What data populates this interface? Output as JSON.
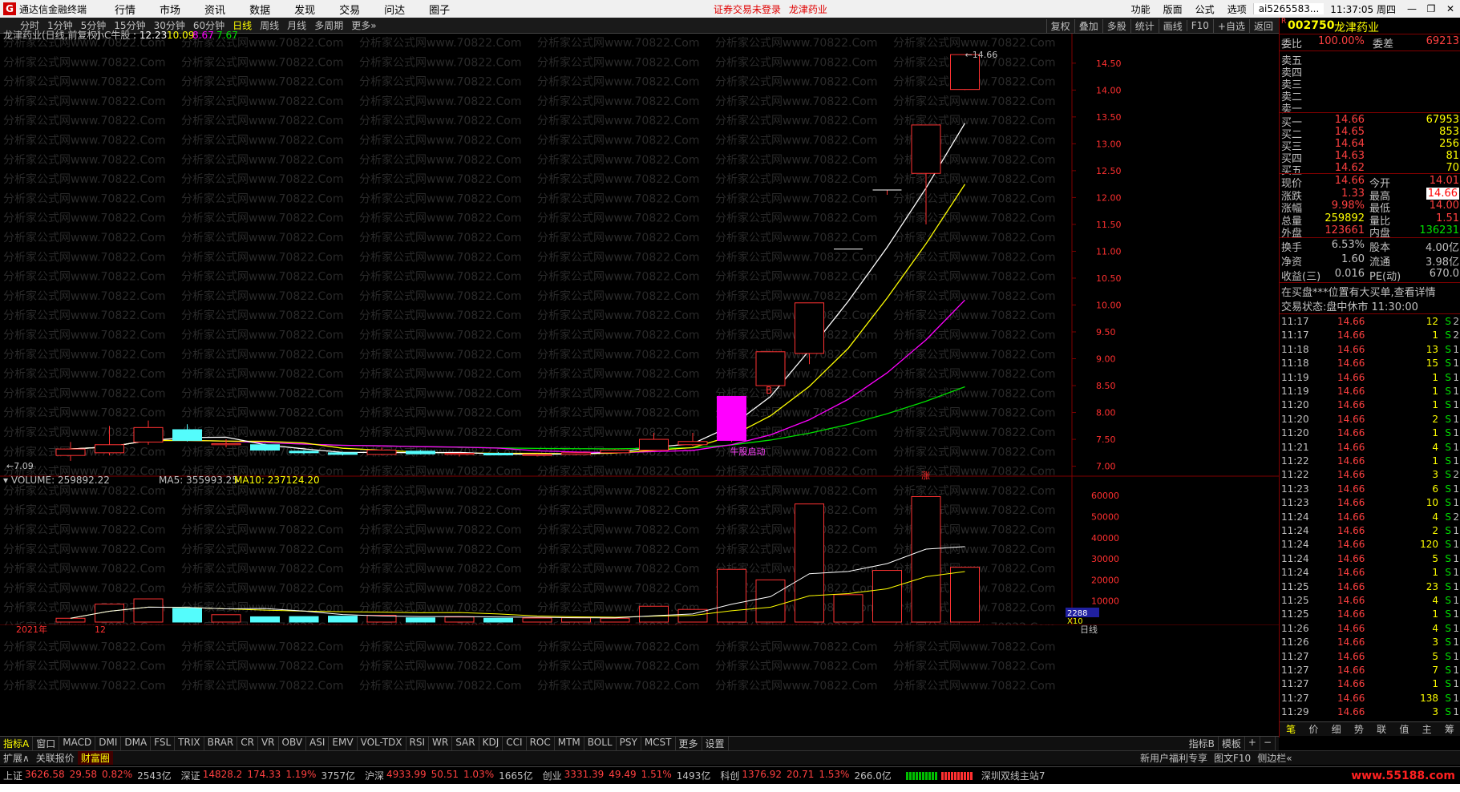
{
  "menubar": {
    "app_title": "通达信金融终端",
    "items": [
      "行情",
      "市场",
      "资讯",
      "数据",
      "发现",
      "交易",
      "问达",
      "圈子"
    ],
    "notice": [
      "证券交易未登录",
      "龙津药业"
    ],
    "right_items": [
      "功能",
      "版面",
      "公式",
      "选项"
    ],
    "account": "ai5265583...",
    "clock": "11:37:05 周四"
  },
  "periods": [
    "分时",
    "1分钟",
    "5分钟",
    "15分钟",
    "30分钟",
    "60分钟",
    "日线",
    "周线",
    "月线",
    "多周期",
    "更多»"
  ],
  "right_tools": [
    "复权",
    "叠加",
    "多股",
    "统计",
    "画线",
    "F10",
    "+自选",
    "返回"
  ],
  "chart": {
    "title": "龙津药业(日线,前复权)",
    "indicator_name": "小C牛股",
    "ind_a": "12.23",
    "ind_b": "10.09",
    "ind_c": "8.67",
    "ind_d": "7.67",
    "high_label": "14.66",
    "low_label": "7.09",
    "signal_b": "B",
    "signal_text": "牛股启动",
    "signal_up": "涨",
    "vol_label": "VOLUME: 259892.22",
    "ma5_label": "MA5: 355993.25",
    "ma10_label": "MA10: 237124.20",
    "year_label": "2021年",
    "month_label": "12",
    "period_label": "日线",
    "vol_badge": "2288",
    "vol_unit": "X10",
    "watermark": "分析家公式网www.70822.Com"
  },
  "chart_data": {
    "type": "candlestick",
    "ylim": [
      6.8,
      14.9
    ],
    "yticks": [
      7.0,
      7.5,
      8.0,
      8.5,
      9.0,
      9.5,
      10.0,
      10.5,
      11.0,
      11.5,
      12.0,
      12.5,
      13.0,
      13.5,
      14.0,
      14.5
    ],
    "candles": [
      {
        "o": 7.2,
        "h": 7.45,
        "l": 7.1,
        "c": 7.32
      },
      {
        "o": 7.25,
        "h": 7.75,
        "l": 7.2,
        "c": 7.4
      },
      {
        "o": 7.45,
        "h": 7.85,
        "l": 7.4,
        "c": 7.72
      },
      {
        "o": 7.68,
        "h": 7.78,
        "l": 7.46,
        "c": 7.48
      },
      {
        "o": 7.4,
        "h": 7.5,
        "l": 7.35,
        "c": 7.42
      },
      {
        "o": 7.4,
        "h": 7.42,
        "l": 7.28,
        "c": 7.3
      },
      {
        "o": 7.28,
        "h": 7.3,
        "l": 7.22,
        "c": 7.25
      },
      {
        "o": 7.25,
        "h": 7.27,
        "l": 7.2,
        "c": 7.22
      },
      {
        "o": 7.22,
        "h": 7.35,
        "l": 7.2,
        "c": 7.3
      },
      {
        "o": 7.28,
        "h": 7.3,
        "l": 7.22,
        "c": 7.23
      },
      {
        "o": 7.22,
        "h": 7.25,
        "l": 7.18,
        "c": 7.24
      },
      {
        "o": 7.24,
        "h": 7.26,
        "l": 7.2,
        "c": 7.21
      },
      {
        "o": 7.2,
        "h": 7.23,
        "l": 7.18,
        "c": 7.22
      },
      {
        "o": 7.22,
        "h": 7.26,
        "l": 7.2,
        "c": 7.25
      },
      {
        "o": 7.25,
        "h": 7.32,
        "l": 7.24,
        "c": 7.3
      },
      {
        "o": 7.3,
        "h": 7.62,
        "l": 7.28,
        "c": 7.5
      },
      {
        "o": 7.4,
        "h": 7.62,
        "l": 7.38,
        "c": 7.46
      },
      {
        "o": 7.48,
        "h": 8.3,
        "l": 7.45,
        "c": 8.3
      },
      {
        "o": 8.5,
        "h": 9.13,
        "l": 8.5,
        "c": 9.13
      },
      {
        "o": 9.1,
        "h": 10.04,
        "l": 8.9,
        "c": 10.04
      },
      {
        "o": 11.04,
        "h": 11.04,
        "l": 11.04,
        "c": 11.04
      },
      {
        "o": 12.14,
        "h": 12.14,
        "l": 12.05,
        "c": 12.14
      },
      {
        "o": 12.45,
        "h": 13.35,
        "l": 11.5,
        "c": 13.35
      },
      {
        "o": 14.01,
        "h": 14.66,
        "l": 14.0,
        "c": 14.66
      }
    ],
    "volume_ylim": [
      0,
      65000
    ],
    "volume_ticks": [
      10000,
      20000,
      30000,
      40000,
      50000,
      60000
    ],
    "volumes": [
      1800,
      8500,
      11000,
      6500,
      3500,
      2500,
      2600,
      2800,
      3200,
      2000,
      2400,
      1800,
      1900,
      2000,
      1800,
      7500,
      6000,
      25000,
      20000,
      56000,
      13000,
      24500,
      59500,
      26000
    ]
  },
  "sidebar": {
    "code": "002750",
    "name": "龙津药业",
    "weibi_label": "委比",
    "weibi": "100.00%",
    "weicha_label": "委差",
    "weicha": "69213",
    "asks": [
      "卖五",
      "卖四",
      "卖三",
      "卖二",
      "卖一"
    ],
    "bids": [
      {
        "l": "买一",
        "p": "14.66",
        "v": "67953"
      },
      {
        "l": "买二",
        "p": "14.65",
        "v": "853"
      },
      {
        "l": "买三",
        "p": "14.64",
        "v": "256"
      },
      {
        "l": "买四",
        "p": "14.63",
        "v": "81"
      },
      {
        "l": "买五",
        "p": "14.62",
        "v": "70"
      }
    ],
    "quote": [
      {
        "l": "现价",
        "a": "14.66",
        "l2": "今开",
        "b": "14.01"
      },
      {
        "l": "涨跌",
        "a": "1.33",
        "l2": "最高",
        "b": "14.66"
      },
      {
        "l": "涨幅",
        "a": "9.98%",
        "l2": "最低",
        "b": "14.00"
      },
      {
        "l": "总量",
        "a": "259892",
        "l2": "量比",
        "b": "1.51"
      },
      {
        "l": "外盘",
        "a": "123661",
        "l2": "内盘",
        "b": "136231"
      }
    ],
    "fund": [
      {
        "l": "换手",
        "a": "6.53%",
        "l2": "股本",
        "b": "4.00亿"
      },
      {
        "l": "净资",
        "a": "1.60",
        "l2": "流通",
        "b": "3.98亿"
      },
      {
        "l": "收益(三)",
        "a": "0.016",
        "l2": "PE(动)",
        "b": "670.0"
      }
    ],
    "msg1": "在买盘***位置有大买单,查看详情",
    "msg2": "交易状态:盘中休市 11:30:00",
    "ticks": [
      {
        "t": "11:17",
        "p": "14.66",
        "v": "12",
        "n": "2"
      },
      {
        "t": "11:17",
        "p": "14.66",
        "v": "1",
        "n": "2"
      },
      {
        "t": "11:18",
        "p": "14.66",
        "v": "13",
        "n": "1"
      },
      {
        "t": "11:18",
        "p": "14.66",
        "v": "15",
        "n": "1"
      },
      {
        "t": "11:19",
        "p": "14.66",
        "v": "1",
        "n": "1"
      },
      {
        "t": "11:19",
        "p": "14.66",
        "v": "1",
        "n": "1"
      },
      {
        "t": "11:20",
        "p": "14.66",
        "v": "1",
        "n": "1"
      },
      {
        "t": "11:20",
        "p": "14.66",
        "v": "2",
        "n": "1"
      },
      {
        "t": "11:20",
        "p": "14.66",
        "v": "1",
        "n": "1"
      },
      {
        "t": "11:21",
        "p": "14.66",
        "v": "4",
        "n": "1"
      },
      {
        "t": "11:22",
        "p": "14.66",
        "v": "1",
        "n": "1"
      },
      {
        "t": "11:22",
        "p": "14.66",
        "v": "3",
        "n": "2"
      },
      {
        "t": "11:23",
        "p": "14.66",
        "v": "6",
        "n": "1"
      },
      {
        "t": "11:23",
        "p": "14.66",
        "v": "10",
        "n": "1"
      },
      {
        "t": "11:24",
        "p": "14.66",
        "v": "4",
        "n": "2"
      },
      {
        "t": "11:24",
        "p": "14.66",
        "v": "2",
        "n": "1"
      },
      {
        "t": "11:24",
        "p": "14.66",
        "v": "120",
        "n": "1"
      },
      {
        "t": "11:24",
        "p": "14.66",
        "v": "5",
        "n": "1"
      },
      {
        "t": "11:24",
        "p": "14.66",
        "v": "1",
        "n": "1"
      },
      {
        "t": "11:25",
        "p": "14.66",
        "v": "23",
        "n": "1"
      },
      {
        "t": "11:25",
        "p": "14.66",
        "v": "4",
        "n": "1"
      },
      {
        "t": "11:25",
        "p": "14.66",
        "v": "1",
        "n": "1"
      },
      {
        "t": "11:26",
        "p": "14.66",
        "v": "4",
        "n": "1"
      },
      {
        "t": "11:26",
        "p": "14.66",
        "v": "3",
        "n": "1"
      },
      {
        "t": "11:27",
        "p": "14.66",
        "v": "5",
        "n": "1"
      },
      {
        "t": "11:27",
        "p": "14.66",
        "v": "7",
        "n": "1"
      },
      {
        "t": "11:27",
        "p": "14.66",
        "v": "1",
        "n": "1"
      },
      {
        "t": "11:27",
        "p": "14.66",
        "v": "138",
        "n": "1"
      },
      {
        "t": "11:29",
        "p": "14.66",
        "v": "3",
        "n": "1"
      }
    ],
    "tick_side": "S",
    "bottom_tabs": [
      "笔",
      "价",
      "细",
      "势",
      "联",
      "值",
      "主",
      "筹"
    ]
  },
  "tabs": [
    "指标A",
    "窗口",
    "MACD",
    "DMI",
    "DMA",
    "FSL",
    "TRIX",
    "BRAR",
    "CR",
    "VR",
    "OBV",
    "ASI",
    "EMV",
    "VOL-TDX",
    "RSI",
    "WR",
    "SAR",
    "KDJ",
    "CCI",
    "ROC",
    "MTM",
    "BOLL",
    "PSY",
    "MCST",
    "更多",
    "设置"
  ],
  "tabs_right": [
    "指标B",
    "模板",
    "+",
    "−"
  ],
  "tabs2": [
    "扩展∧",
    "关联报价",
    "财富圈"
  ],
  "tabs2_right": [
    "新用户福利专享",
    "图文F10",
    "侧边栏«"
  ],
  "status": [
    {
      "n": "上证",
      "v": "3626.58",
      "c": "29.58",
      "p": "0.82%",
      "a": "2543亿"
    },
    {
      "n": "深证",
      "v": "14828.2",
      "c": "174.33",
      "p": "1.19%",
      "a": "3757亿"
    },
    {
      "n": "沪深",
      "v": "4933.99",
      "c": "50.51",
      "p": "1.03%",
      "a": "1665亿"
    },
    {
      "n": "创业",
      "v": "3331.39",
      "c": "49.49",
      "p": "1.51%",
      "a": "1493亿"
    },
    {
      "n": "科创",
      "v": "1376.92",
      "c": "20.71",
      "p": "1.53%",
      "a": "266.0亿"
    }
  ],
  "status_right": "深圳双线主站7",
  "site_mark": "www.55188.com",
  "colors": {
    "up": "#ff3232",
    "down": "#54fcfc",
    "ma_white": "#ffffff",
    "ma_yellow": "#ffff00",
    "ma_magenta": "#ff00ff",
    "ma_green": "#00e000"
  }
}
